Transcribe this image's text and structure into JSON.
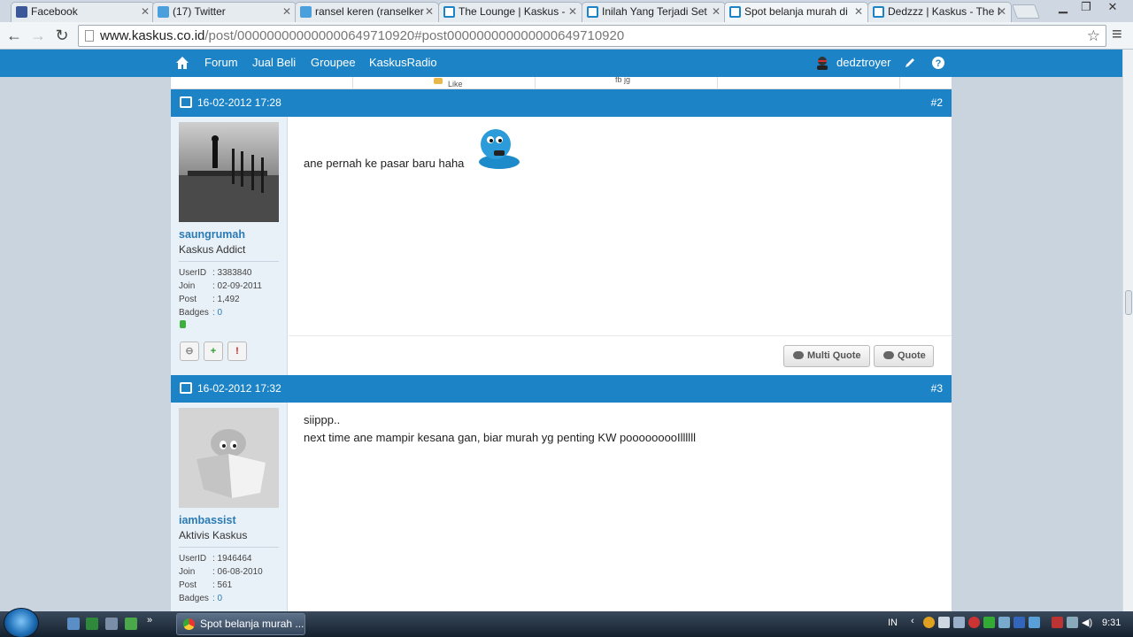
{
  "browser": {
    "tabs": [
      {
        "title": "Facebook",
        "color": "#3b5998"
      },
      {
        "title": "(17) Twitter",
        "color": "#4aa0dd"
      },
      {
        "title": "ransel keren (ranselker",
        "color": "#4aa0dd"
      },
      {
        "title": "The Lounge | Kaskus -",
        "color": "#1c84c6"
      },
      {
        "title": "Inilah Yang Terjadi Set",
        "color": "#1c84c6"
      },
      {
        "title": "Spot belanja murah di",
        "color": "#1c84c6"
      },
      {
        "title": "Dedzzz | Kaskus - The I",
        "color": "#1c84c6"
      }
    ],
    "active_tab": 5,
    "url_domain": "www.kaskus.co.id",
    "url_path": "/post/000000000000000649710920#post000000000000000649710920"
  },
  "site": {
    "nav": [
      "Forum",
      "Jual Beli",
      "Groupee",
      "KaskusRadio"
    ],
    "username": "dedztroyer"
  },
  "prev_row": {
    "like_label": "Like",
    "tail_text": "fb jg"
  },
  "posts": [
    {
      "datetime": "16-02-2012 17:28",
      "number": "#2",
      "username": "saungrumah",
      "rank": "Kaskus Addict",
      "info": [
        {
          "label": "UserID",
          "value": ": 3383840"
        },
        {
          "label": "Join",
          "value": ": 02-09-2011"
        },
        {
          "label": "Post",
          "value": ": 1,492"
        },
        {
          "label": "Badges",
          "value": ": 0"
        }
      ],
      "lines": [
        "ane pernah ke pasar baru haha"
      ],
      "multi_quote": "Multi Quote",
      "quote": "Quote"
    },
    {
      "datetime": "16-02-2012 17:32",
      "number": "#3",
      "username": "iambassist",
      "rank": "Aktivis Kaskus",
      "info": [
        {
          "label": "UserID",
          "value": ": 1946464"
        },
        {
          "label": "Join",
          "value": ": 06-08-2010"
        },
        {
          "label": "Post",
          "value": ": 561"
        },
        {
          "label": "Badges",
          "value": ": 0"
        }
      ],
      "lines": [
        "siippp..",
        "next time ane mampir kesana gan, biar murah yg penting KW pooooooooIllllll"
      ]
    }
  ],
  "taskbar": {
    "window_title": "Spot belanja murah ...",
    "lang": "IN",
    "clock": "9:31"
  }
}
